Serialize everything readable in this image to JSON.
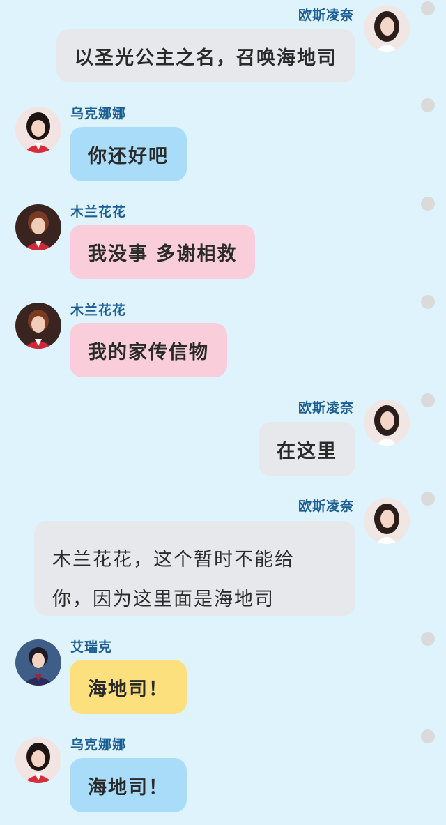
{
  "messages": [
    {
      "sender": "欧斯凌奈",
      "side": "right",
      "text": "以圣光公主之名，召唤海地司",
      "color": "gray",
      "avatar": "avatar-osling"
    },
    {
      "sender": "乌克娜娜",
      "side": "left",
      "text": "你还好吧",
      "color": "blue",
      "avatar": "avatar-ukenana"
    },
    {
      "sender": "木兰花花",
      "side": "left",
      "text": "我没事 多谢相救",
      "color": "pink",
      "avatar": "avatar-mulan"
    },
    {
      "sender": "木兰花花",
      "side": "left",
      "text": "我的家传信物",
      "color": "pink",
      "avatar": "avatar-mulan"
    },
    {
      "sender": "欧斯凌奈",
      "side": "right",
      "text": "在这里",
      "color": "gray",
      "avatar": "avatar-osling"
    },
    {
      "sender": "欧斯凌奈",
      "side": "right",
      "text_line1": "木兰花花，这个暂时不能给",
      "text_line2": "你，因为这里面是海地司",
      "color": "gray",
      "avatar": "avatar-osling"
    },
    {
      "sender": "艾瑞克",
      "side": "left",
      "text": "海地司！",
      "color": "yellow",
      "avatar": "avatar-eric"
    },
    {
      "sender": "乌克娜娜",
      "side": "left",
      "text": "海地司！",
      "color": "blue",
      "avatar": "avatar-ukenana"
    }
  ],
  "colors": {
    "background": "#dff3fc",
    "name": "#1b5e95",
    "gray_bubble": "#e6e8ec",
    "blue_bubble": "#a9dcf9",
    "pink_bubble": "#f9cdd9",
    "yellow_bubble": "#fde07e",
    "dot": "#dadada"
  }
}
